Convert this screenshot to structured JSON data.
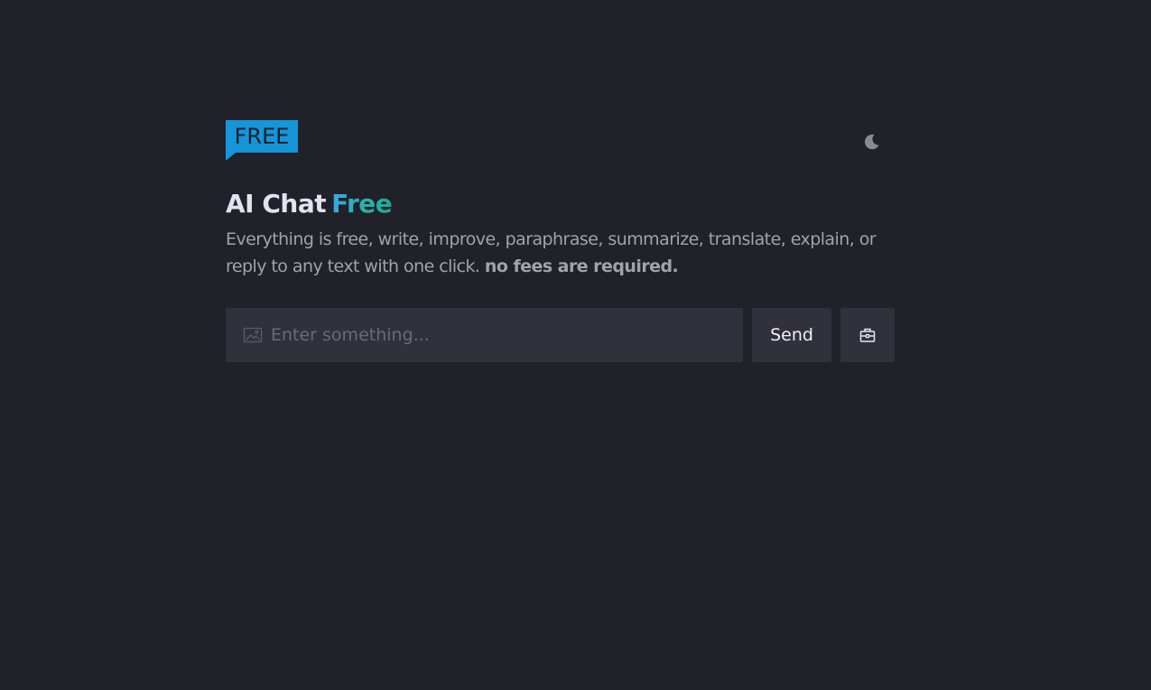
{
  "logo": {
    "text": "FREE",
    "color": "#1695d8"
  },
  "theme_toggle": {
    "icon": "moon-icon"
  },
  "title": {
    "main": "AI Chat",
    "accent": "Free"
  },
  "description": {
    "text": "Everything is free, write, improve, paraphrase, summarize, translate, explain, or reply to any text with one click.",
    "emphasis": "no fees are required."
  },
  "chat_input": {
    "placeholder": "Enter something...",
    "value": "",
    "icon": "image-icon"
  },
  "buttons": {
    "send_label": "Send",
    "tool_icon": "toolbox-icon"
  },
  "colors": {
    "background": "#21212a",
    "surface": "#30313a",
    "accent_start": "#3aa7e4",
    "accent_end": "#1ea896"
  }
}
